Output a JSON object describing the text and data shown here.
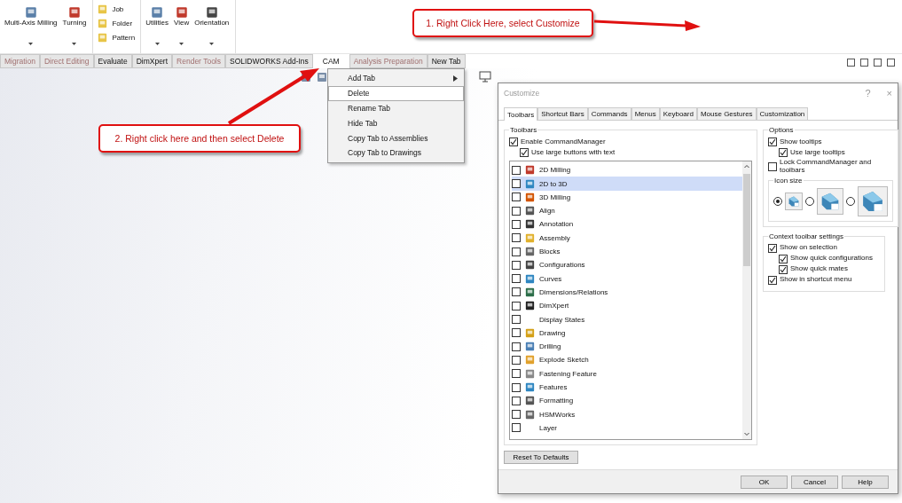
{
  "ribbon": {
    "groups": [
      {
        "kind": "large",
        "items": [
          {
            "label": "Multi-Axis Milling"
          },
          {
            "label": "Turning"
          }
        ]
      },
      {
        "kind": "small",
        "items": [
          {
            "label": "Job"
          },
          {
            "label": "Folder"
          },
          {
            "label": "Pattern"
          }
        ]
      },
      {
        "kind": "large",
        "items": [
          {
            "label": "Utilities"
          },
          {
            "label": "View"
          },
          {
            "label": "Orientation"
          }
        ]
      }
    ]
  },
  "command_tabs": [
    {
      "label": "Migration",
      "disabled": true,
      "selected": false
    },
    {
      "label": "Direct Editing",
      "disabled": true,
      "selected": false
    },
    {
      "label": "Evaluate",
      "disabled": false,
      "selected": false
    },
    {
      "label": "DimXpert",
      "disabled": false,
      "selected": false
    },
    {
      "label": "Render Tools",
      "disabled": true,
      "selected": false
    },
    {
      "label": "SOLIDWORKS Add-Ins",
      "disabled": false,
      "selected": false
    },
    {
      "label": "CAM",
      "disabled": false,
      "selected": true
    },
    {
      "label": "Analysis Preparation",
      "disabled": true,
      "selected": false
    },
    {
      "label": "New Tab",
      "disabled": false,
      "selected": false
    }
  ],
  "context_menu": {
    "items": [
      {
        "label": "Add Tab",
        "submenu": true,
        "selected": false
      },
      {
        "label": "Delete",
        "submenu": false,
        "selected": true
      },
      {
        "label": "Rename Tab",
        "submenu": false,
        "selected": false
      },
      {
        "label": "Hide Tab",
        "submenu": false,
        "selected": false
      },
      {
        "label": "Copy Tab to Assemblies",
        "submenu": false,
        "selected": false
      },
      {
        "label": "Copy Tab to Drawings",
        "submenu": false,
        "selected": false
      }
    ]
  },
  "callouts": [
    {
      "text": "1. Right Click Here, select Customize"
    },
    {
      "text": "2. Right click here and then select Delete"
    }
  ],
  "dialog": {
    "title": "Customize",
    "help": "?",
    "close": "×",
    "tabs": [
      {
        "label": "Toolbars",
        "selected": true
      },
      {
        "label": "Shortcut Bars",
        "selected": false
      },
      {
        "label": "Commands",
        "selected": false
      },
      {
        "label": "Menus",
        "selected": false
      },
      {
        "label": "Keyboard",
        "selected": false
      },
      {
        "label": "Mouse Gestures",
        "selected": false
      },
      {
        "label": "Customization",
        "selected": false
      }
    ],
    "toolbars_group": {
      "title": "Toolbars",
      "options": [
        {
          "label": "Enable CommandManager",
          "checked": true,
          "children": [
            {
              "label": "Use large buttons with text",
              "checked": true
            }
          ]
        }
      ],
      "list": [
        {
          "label": "2D Milling",
          "checked": false,
          "selected": false,
          "has_icon": true
        },
        {
          "label": "2D to 3D",
          "checked": false,
          "selected": true,
          "has_icon": true
        },
        {
          "label": "3D Milling",
          "checked": false,
          "selected": false,
          "has_icon": true
        },
        {
          "label": "Align",
          "checked": false,
          "selected": false,
          "has_icon": true
        },
        {
          "label": "Annotation",
          "checked": false,
          "selected": false,
          "has_icon": true
        },
        {
          "label": "Assembly",
          "checked": false,
          "selected": false,
          "has_icon": true
        },
        {
          "label": "Blocks",
          "checked": false,
          "selected": false,
          "has_icon": true
        },
        {
          "label": "Configurations",
          "checked": false,
          "selected": false,
          "has_icon": true
        },
        {
          "label": "Curves",
          "checked": false,
          "selected": false,
          "has_icon": true
        },
        {
          "label": "Dimensions/Relations",
          "checked": false,
          "selected": false,
          "has_icon": true
        },
        {
          "label": "DimXpert",
          "checked": false,
          "selected": false,
          "has_icon": true
        },
        {
          "label": "Display States",
          "checked": false,
          "selected": false,
          "has_icon": false
        },
        {
          "label": "Drawing",
          "checked": false,
          "selected": false,
          "has_icon": true
        },
        {
          "label": "Drilling",
          "checked": false,
          "selected": false,
          "has_icon": true
        },
        {
          "label": "Explode Sketch",
          "checked": false,
          "selected": false,
          "has_icon": true
        },
        {
          "label": "Fastening Feature",
          "checked": false,
          "selected": false,
          "has_icon": true
        },
        {
          "label": "Features",
          "checked": false,
          "selected": false,
          "has_icon": true
        },
        {
          "label": "Formatting",
          "checked": false,
          "selected": false,
          "has_icon": true
        },
        {
          "label": "HSMWorks",
          "checked": false,
          "selected": false,
          "has_icon": true
        },
        {
          "label": "Layer",
          "checked": false,
          "selected": false,
          "has_icon": false
        }
      ]
    },
    "options_group": {
      "title": "Options",
      "options": [
        {
          "label": "Show tooltips",
          "checked": true,
          "children": [
            {
              "label": "Use large tooltips",
              "checked": true
            }
          ]
        },
        {
          "label": "Lock CommandManager and toolbars",
          "checked": false
        }
      ],
      "icon_size": {
        "title": "Icon size",
        "sizes": [
          {
            "selected": true
          },
          {
            "selected": false
          },
          {
            "selected": false
          }
        ]
      }
    },
    "context_group": {
      "title": "Context toolbar settings",
      "options": [
        {
          "label": "Show on selection",
          "checked": true,
          "children": [
            {
              "label": "Show quick configurations",
              "checked": true
            },
            {
              "label": "Show quick mates",
              "checked": true
            }
          ]
        },
        {
          "label": "Show in shortcut menu",
          "checked": true
        }
      ]
    },
    "reset_button": "Reset To Defaults",
    "buttons": [
      "OK",
      "Cancel",
      "Help"
    ]
  }
}
